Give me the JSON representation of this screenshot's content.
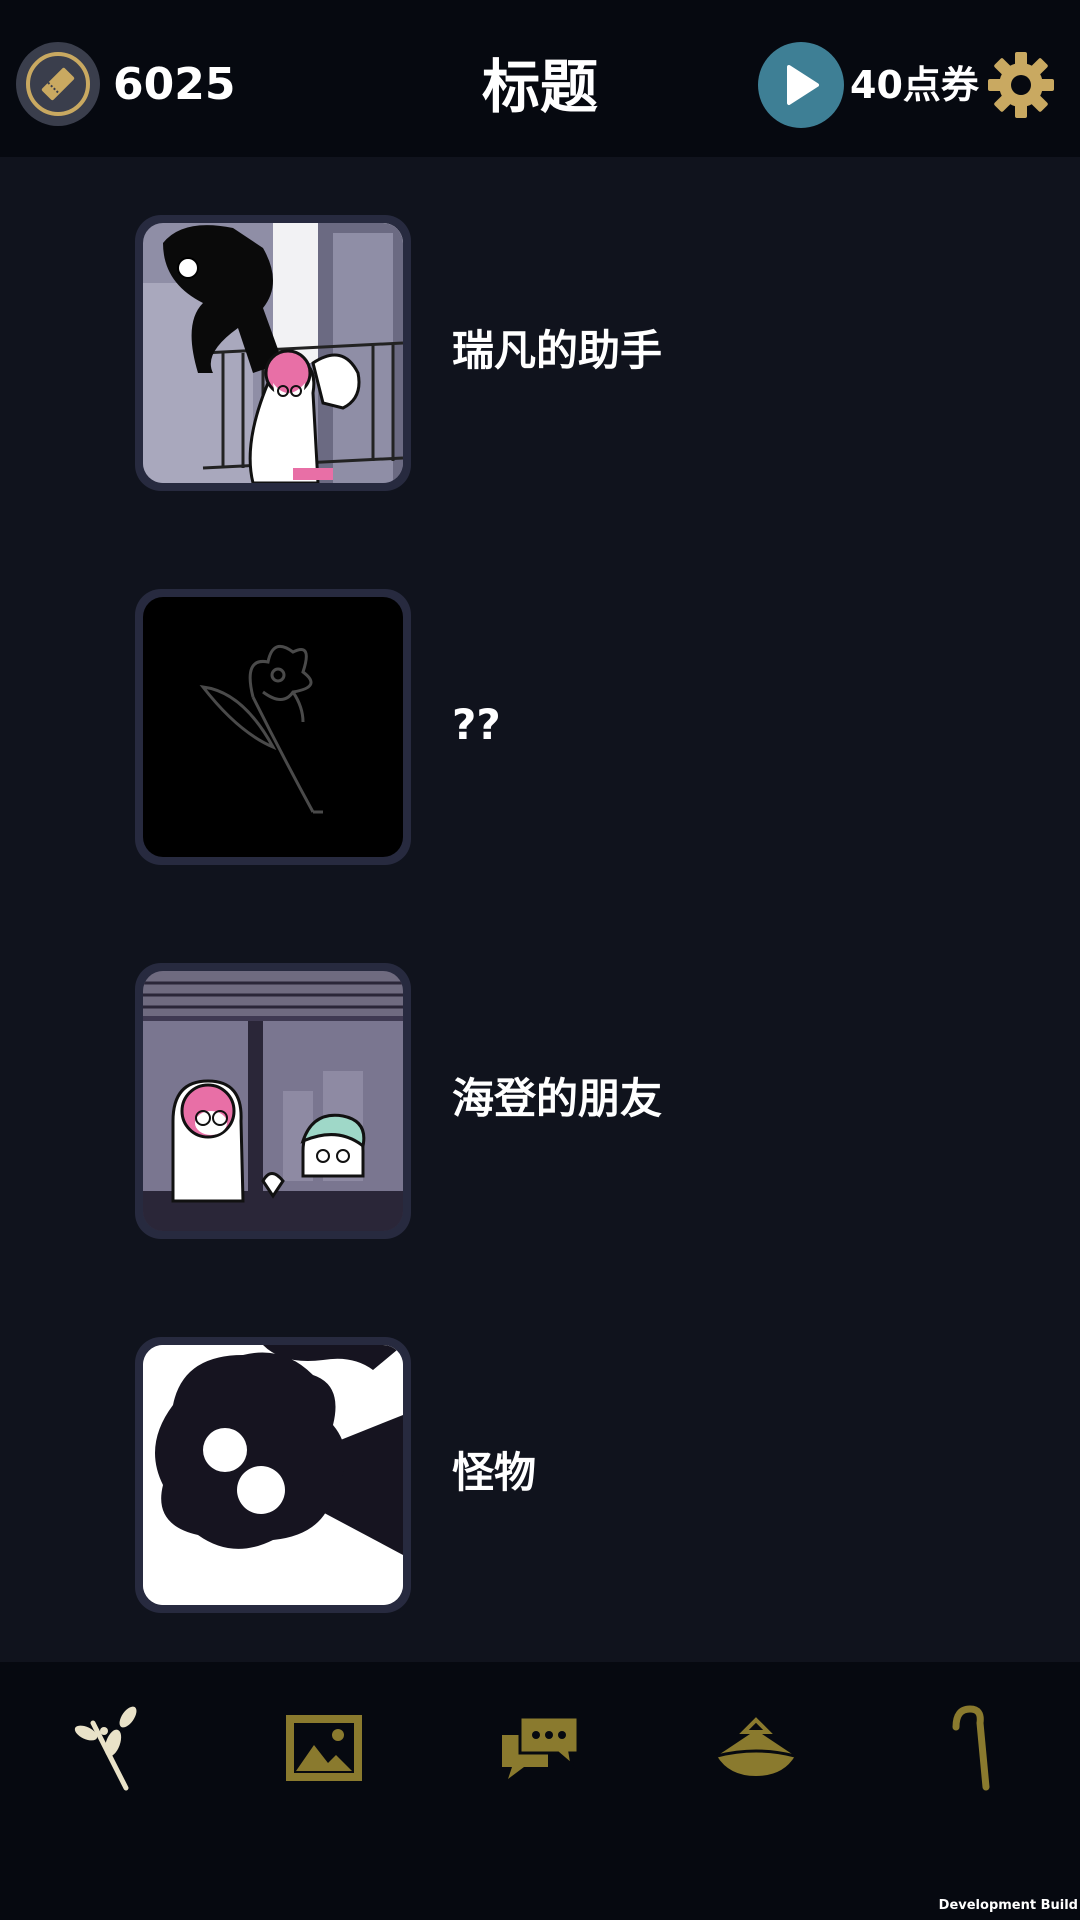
{
  "header": {
    "coin_icon": "ticket-coin-icon",
    "coin_count": "6025",
    "title": "标题",
    "play_icon": "play-icon",
    "points": "40点券",
    "settings_icon": "gear-icon"
  },
  "items": [
    {
      "label": "瑞凡的助手",
      "image": "balcony-illustration"
    },
    {
      "label": "??",
      "image": "flower-sketch-dark"
    },
    {
      "label": "海登的朋友",
      "image": "window-illustration"
    },
    {
      "label": "怪物",
      "image": "monster-illustration"
    }
  ],
  "bottom_nav": [
    {
      "icon": "sprig-icon",
      "active": true
    },
    {
      "icon": "gallery-icon",
      "active": false
    },
    {
      "icon": "chat-icon",
      "active": false
    },
    {
      "icon": "hat-icon",
      "active": false
    },
    {
      "icon": "cane-icon",
      "active": false
    }
  ],
  "footer": {
    "build_label": "Development Build"
  },
  "colors": {
    "background": "#10131d",
    "header": "#060910",
    "gold": "#c9a961",
    "olive": "#8a7a2e",
    "play": "#3e7f95"
  }
}
